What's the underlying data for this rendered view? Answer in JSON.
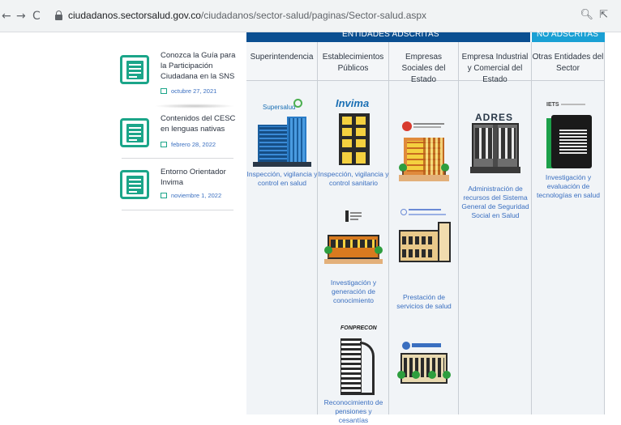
{
  "browser": {
    "back_icon": "back-arrow-icon",
    "forward_icon": "forward-arrow-icon",
    "reload_icon": "reload-icon",
    "url_domain": "ciudadanos.sectorsalud.gov.co",
    "url_path": "/ciudadanos/sector-salud/paginas/Sector-salud.aspx"
  },
  "news": [
    {
      "title": "Conozca la Guía para la Participación Ciudadana en la SNS",
      "date": "octubre 27, 2021"
    },
    {
      "title": "Contenidos del CESC en lenguas nativas",
      "date": "febrero 28, 2022"
    },
    {
      "title": "Entorno Orientador Invima",
      "date": "noviembre 1, 2022"
    }
  ],
  "table": {
    "header_left": "ENTIDADES ADSCRITAS",
    "header_right": "NO ADSCRITAS",
    "columns": [
      {
        "head": "Superintendencia"
      },
      {
        "head": "Establecimientos Públicos"
      },
      {
        "head": "Empresas Sociales del Estado"
      },
      {
        "head": "Empresa Industrial y Comercial del Estado"
      },
      {
        "head": "Otras Entidades del Sector"
      }
    ],
    "captions": {
      "supersalud": "Inspección, vigilancia y control en salud",
      "invima": "Inspección, vigilancia y control sanitario",
      "investigacion": "Investigación y generación de conocimiento",
      "fonprecon": "Reconocimiento de pensiones y cesantías",
      "prestacion": "Prestación de servicios de salud",
      "adres": "Administración de recursos del Sistema General de Seguridad Social en Salud",
      "iets": "Investigación y evaluación de tecnologías en salud"
    },
    "logos": {
      "supersalud": "Supersalud",
      "invima": "Invima",
      "adres": "ADRES",
      "fonprecon": "FONPRECON",
      "iets": "IETS"
    }
  }
}
